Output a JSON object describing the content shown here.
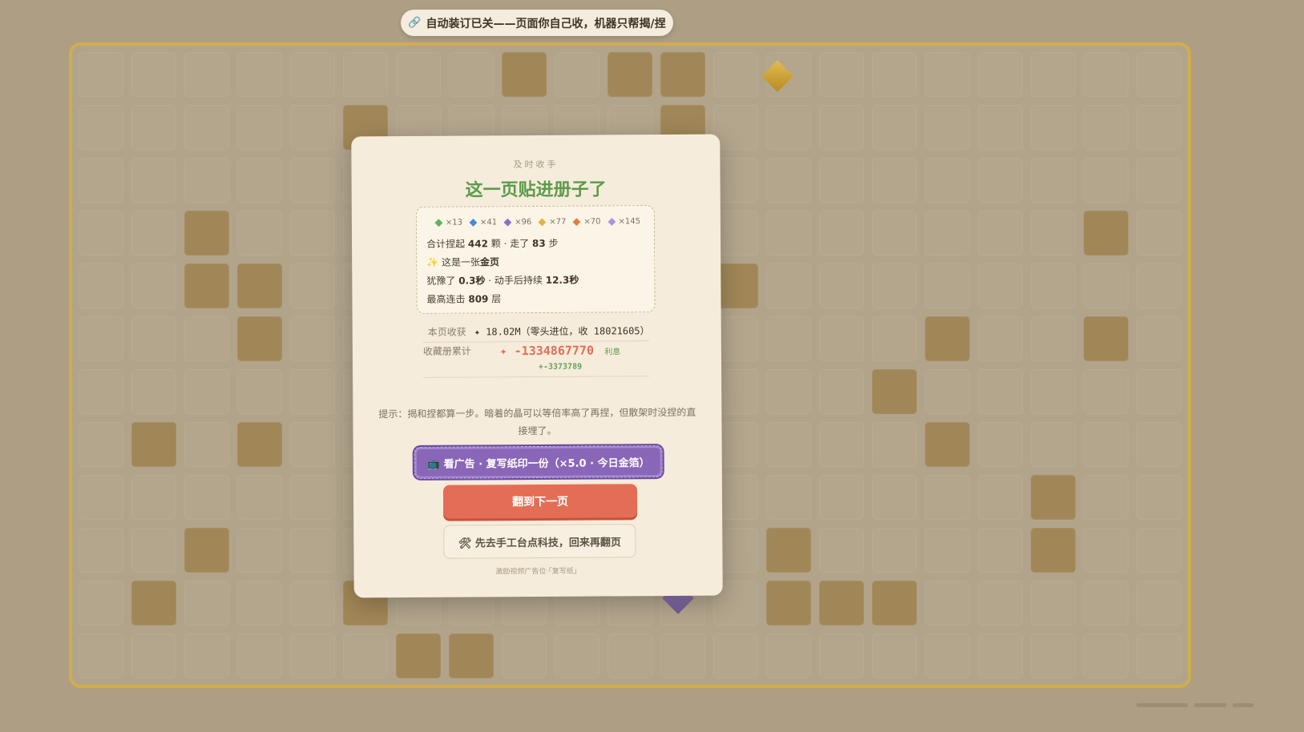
{
  "banner": {
    "icon": "link-icon",
    "text": "自动装订已关——页面你自己收，机器只帮揭/捏"
  },
  "modal": {
    "kicker": "及时收手",
    "title": "这一页贴进册子了",
    "gems": [
      {
        "count": "×13",
        "color": "#5fb15a",
        "icon": "green-gem-icon"
      },
      {
        "count": "×41",
        "color": "#4f86d6",
        "icon": "blue-gem-icon"
      },
      {
        "count": "×96",
        "color": "#8b72c6",
        "icon": "purple-gem-icon"
      },
      {
        "count": "×77",
        "color": "#e0b544",
        "icon": "gold-gem-icon"
      },
      {
        "count": "×70",
        "color": "#e0803e",
        "icon": "orange-gem-icon"
      },
      {
        "count": "×145",
        "color": "#a797d8",
        "icon": "lavender-gem-icon"
      }
    ],
    "summary": {
      "picked_prefix": "合计捏起 ",
      "picked": "442",
      "picked_mid": " 颗 · 走了 ",
      "steps": "83",
      "steps_suffix": " 步",
      "gold_prefix": "这是一张",
      "gold_word": "金页",
      "hesitate_prefix": "犹豫了 ",
      "hesitate": "0.3秒",
      "hesitate_mid": " · 动手后持续 ",
      "duration": "12.3秒",
      "combo_prefix": "最高连击 ",
      "combo": "809",
      "combo_suffix": " 层"
    },
    "page_gain": {
      "label": "本页收获",
      "value": "✦ 18.02M（零头进位，收 18021605）"
    },
    "collection": {
      "label": "收藏册累计",
      "value": "✦ -1334867770",
      "interest_label": "利息",
      "interest": "+-3373789"
    },
    "hint": "提示：揭和捏都算一步。暗着的晶可以等倍率高了再捏，但散架时没捏的直接埋了。",
    "buttons": {
      "ad": "看广告 · 复写纸印一份（×5.0 · 今日金箔）",
      "next": "翻到下一页",
      "craft": "先去手工台点科技，回来再翻页"
    },
    "footnote": "激励视频广告位·「复写纸」"
  },
  "colors": {
    "accent_green": "#5c9b4a",
    "accent_red": "#e46e55",
    "accent_purple": "#8a66b8",
    "board_border": "#d1ad4e"
  }
}
